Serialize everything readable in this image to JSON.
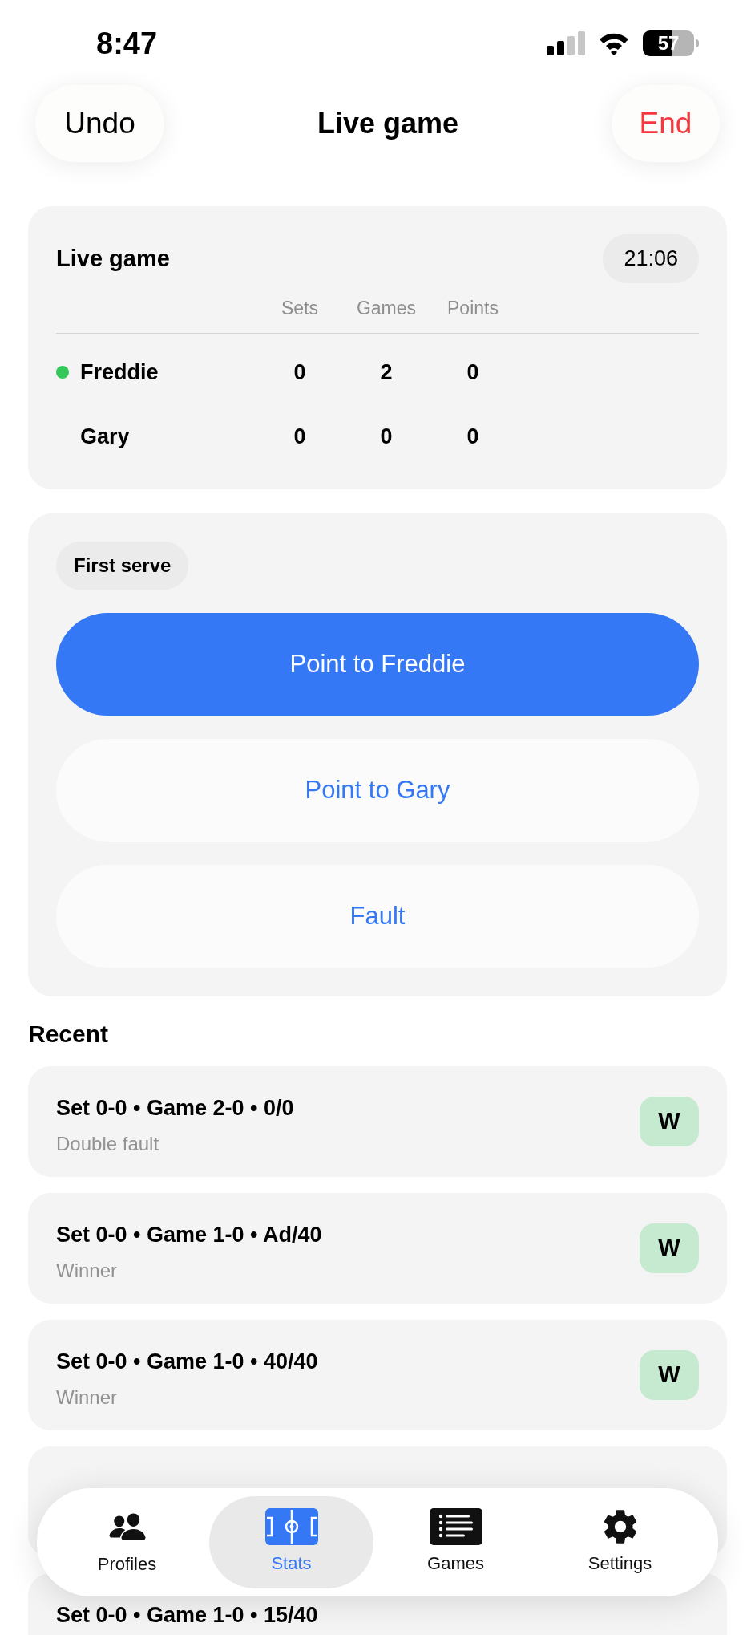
{
  "status_bar": {
    "time": "8:47",
    "battery": "57"
  },
  "header": {
    "left_button": "Undo",
    "title": "Live game",
    "right_button": "End"
  },
  "scoreboard": {
    "title": "Live game",
    "timer": "21:06",
    "columns": [
      "Sets",
      "Games",
      "Points"
    ],
    "players": [
      {
        "name": "Freddie",
        "serving": true,
        "scores": [
          "0",
          "2",
          "0"
        ]
      },
      {
        "name": "Gary",
        "serving": false,
        "scores": [
          "0",
          "0",
          "0"
        ]
      }
    ]
  },
  "actions": {
    "serve_label": "First serve",
    "buttons": [
      {
        "label": "Point to Freddie",
        "kind": "primary"
      },
      {
        "label": "Point to Gary",
        "kind": "secondary"
      },
      {
        "label": "Fault",
        "kind": "secondary"
      }
    ]
  },
  "recent": {
    "title": "Recent",
    "items": [
      {
        "kind": "entry",
        "title": "Set 0-0 • Game 2-0 • 0/0",
        "subtitle": "Double fault",
        "result": "W"
      },
      {
        "kind": "entry",
        "title": "Set 0-0 • Game 1-0 • Ad/40",
        "subtitle": "Winner",
        "result": "W"
      },
      {
        "kind": "entry",
        "title": "Set 0-0 • Game 1-0 • 40/40",
        "subtitle": "Winner",
        "result": "W"
      },
      {
        "kind": "covered"
      },
      {
        "kind": "entry",
        "title": "Set 0-0 • Game 1-0 • 15/40"
      }
    ]
  },
  "tab_bar": [
    {
      "label": "Profiles",
      "kind": "people",
      "selected": false
    },
    {
      "label": "Stats",
      "kind": "court",
      "selected": true
    },
    {
      "label": "Games",
      "kind": "list",
      "selected": false
    },
    {
      "label": "Settings",
      "kind": "gear",
      "selected": false
    }
  ]
}
